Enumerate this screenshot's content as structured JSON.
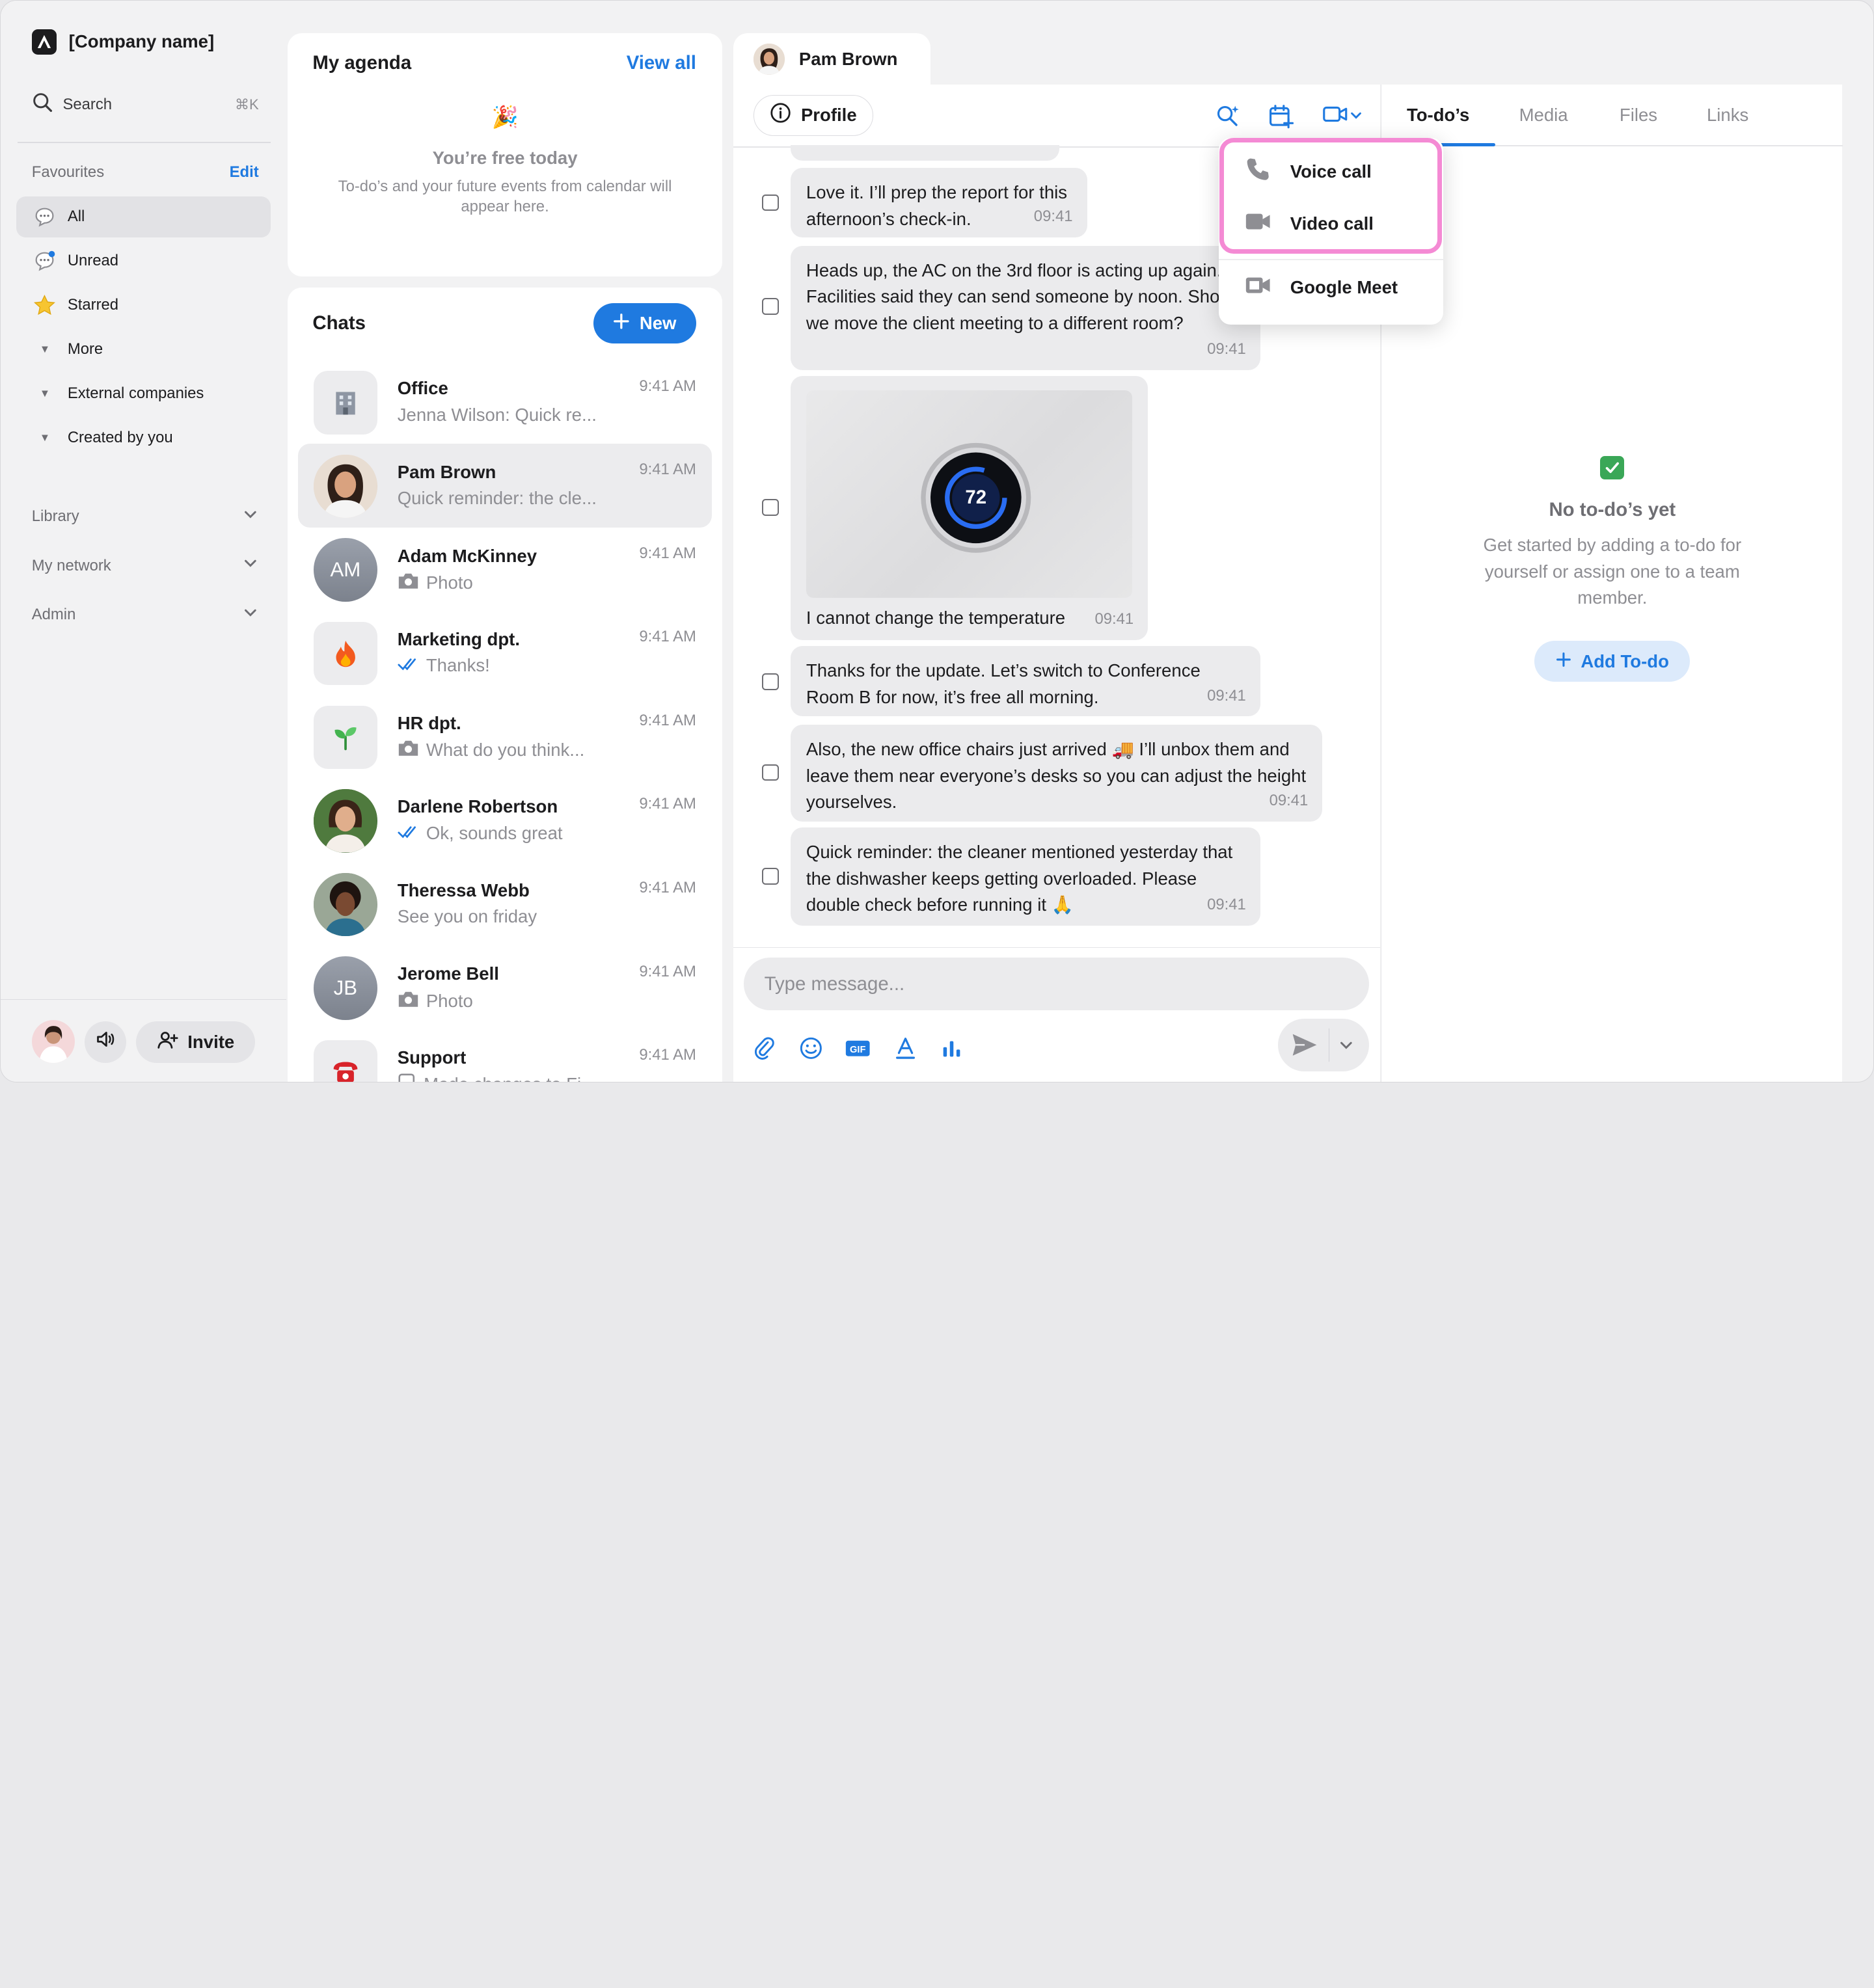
{
  "sidebar": {
    "company_name": "[Company name]",
    "search_label": "Search",
    "search_shortcut": "⌘K",
    "favourites_label": "Favourites",
    "edit_label": "Edit",
    "items": [
      {
        "label": "All",
        "icon": "chat-bubble-icon"
      },
      {
        "label": "Unread",
        "icon": "chat-bubble-unread-icon"
      },
      {
        "label": "Starred",
        "icon": "star-icon"
      },
      {
        "label": "More",
        "icon": "caret-down-icon"
      },
      {
        "label": "External companies",
        "icon": "caret-down-icon"
      },
      {
        "label": "Created by you",
        "icon": "caret-down-icon"
      }
    ],
    "sections": [
      {
        "label": "Library"
      },
      {
        "label": "My network"
      },
      {
        "label": "Admin"
      }
    ],
    "invite_label": "Invite"
  },
  "agenda": {
    "title": "My agenda",
    "view_all": "View all",
    "free_title": "You’re free today",
    "free_desc": "To-do’s and your future events from calendar will appear here."
  },
  "chats": {
    "title": "Chats",
    "new_label": "New",
    "list": [
      {
        "name": "Office",
        "preview": "Jenna Wilson:  Quick re...",
        "time": "9:41 AM",
        "avatar": "office-building-icon",
        "preview_icon": ""
      },
      {
        "name": "Pam Brown",
        "preview": "Quick reminder: the cle...",
        "time": "9:41 AM",
        "avatar": "photo",
        "preview_icon": ""
      },
      {
        "name": "Adam McKinney",
        "preview": "Photo",
        "time": "9:41 AM",
        "avatar": "AM",
        "preview_icon": "camera-icon"
      },
      {
        "name": "Marketing dpt.",
        "preview": "Thanks!",
        "time": "9:41 AM",
        "avatar": "fire-icon",
        "preview_icon": "double-check-icon"
      },
      {
        "name": "HR dpt.",
        "preview": "What do you think...",
        "time": "9:41 AM",
        "avatar": "seedling-icon",
        "preview_icon": "camera-icon"
      },
      {
        "name": "Darlene Robertson",
        "preview": "Ok, sounds great",
        "time": "9:41 AM",
        "avatar": "photo",
        "preview_icon": "double-check-icon"
      },
      {
        "name": "Theressa Webb",
        "preview": "See you on friday",
        "time": "9:41 AM",
        "avatar": "photo",
        "preview_icon": ""
      },
      {
        "name": "Jerome Bell",
        "preview": "Photo",
        "time": "9:41 AM",
        "avatar": "JB",
        "preview_icon": "camera-icon"
      },
      {
        "name": "Support",
        "preview": "Made changes to Fi...",
        "time": "9:41 AM",
        "avatar": "telephone-icon",
        "preview_icon": "checkbox-icon"
      }
    ]
  },
  "conversation": {
    "contact_name": "Pam Brown",
    "profile_label": "Profile",
    "messages": [
      {
        "text": "Love it. I’ll prep the report for this afternoon’s check-in.",
        "time": "09:41"
      },
      {
        "text": "Heads up, the AC on the 3rd floor is acting up again. Facilities said they can send someone by noon. Should we move the client meeting to a different room?",
        "time": "09:41"
      },
      {
        "text": "I cannot change the temperature",
        "time": "09:41",
        "image_text": "72"
      },
      {
        "text": "Thanks for the update. Let’s switch to Conference Room B for now, it’s free all morning.",
        "time": "09:41"
      },
      {
        "text": "Also, the new office chairs just arrived 🚚 I’ll unbox them and leave them near everyone’s desks so you can adjust the height yourselves.",
        "time": "09:41"
      },
      {
        "text": "Quick reminder: the cleaner mentioned yesterday that the dishwasher keeps getting overloaded. Please double check before running it 🙏",
        "time": "09:41"
      }
    ],
    "composer_placeholder": "Type message..."
  },
  "call_menu": {
    "items": [
      {
        "label": "Voice call",
        "icon": "phone-icon"
      },
      {
        "label": "Video call",
        "icon": "video-camera-icon"
      },
      {
        "label": "Google Meet",
        "icon": "google-meet-icon"
      }
    ]
  },
  "right_panel": {
    "tabs": [
      "To-do’s",
      "Media",
      "Files",
      "Links"
    ],
    "empty_title": "No to-do’s yet",
    "empty_desc": "Get started by adding a to-do for yourself or assign one to a team member.",
    "add_label": "Add To-do"
  },
  "colors": {
    "accent": "#1f7ae0",
    "highlight": "#f48ad4",
    "bubble": "#ebebed"
  }
}
